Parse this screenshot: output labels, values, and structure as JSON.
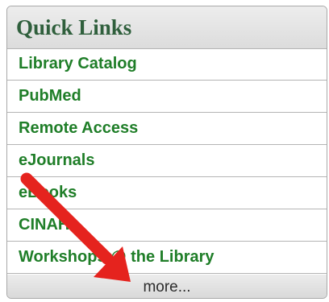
{
  "quick_links": {
    "title": "Quick Links",
    "items": [
      {
        "label": "Library Catalog"
      },
      {
        "label": "PubMed"
      },
      {
        "label": "Remote Access"
      },
      {
        "label": "eJournals"
      },
      {
        "label": "eBooks"
      },
      {
        "label": "CINAHL"
      },
      {
        "label": "Workshops @ the Library"
      }
    ],
    "more_label": "more..."
  },
  "colors": {
    "title": "#2f5f3c",
    "link": "#1f7e28",
    "arrow": "#e5231e"
  },
  "annotation": {
    "icon": "red-arrow-icon"
  }
}
